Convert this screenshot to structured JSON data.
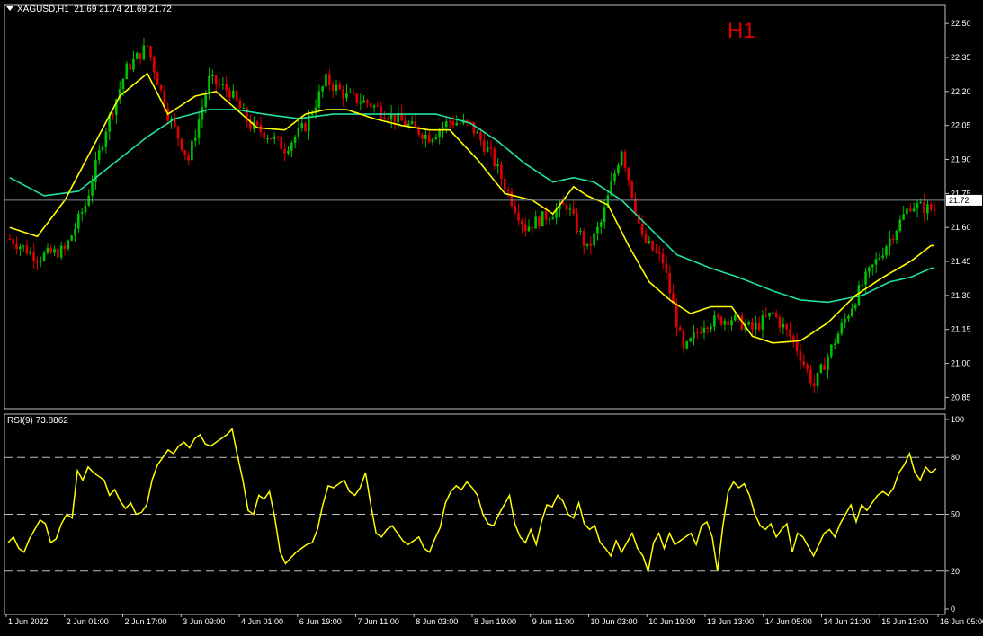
{
  "header": {
    "symbol_label": "XAGUSD,H1",
    "ohlc": "21.69 21.74 21.69 21.72"
  },
  "timeframe_label": "H1",
  "colors": {
    "background": "#000000",
    "axis": "#c0c0c0",
    "bull": "#00c000",
    "bear": "#e00000",
    "ma_fast": "#ffff00",
    "ma_slow": "#20e0a0",
    "rsi": "#ffff00",
    "level_line": "#c0c0c0",
    "current_price_line": "#8090a0"
  },
  "chart_data": [
    {
      "type": "candlestick",
      "title": "XAGUSD,H1",
      "ylim": [
        20.8,
        22.58
      ],
      "price_ticks": [
        "22.50",
        "22.35",
        "22.20",
        "22.05",
        "21.90",
        "21.75",
        "21.60",
        "21.45",
        "21.30",
        "21.15",
        "21.00",
        "20.85"
      ],
      "current_price": "21.72",
      "x_labels": [
        "1 Jun 2022",
        "2 Jun 01:00",
        "2 Jun 17:00",
        "3 Jun 09:00",
        "4 Jun 01:00",
        "6 Jun 19:00",
        "7 Jun 11:00",
        "8 Jun 03:00",
        "8 Jun 19:00",
        "9 Jun 11:00",
        "10 Jun 03:00",
        "10 Jun 19:00",
        "13 Jun 13:00",
        "14 Jun 05:00",
        "14 Jun 21:00",
        "15 Jun 13:00",
        "16 Jun 05:00"
      ],
      "close_path": [
        [
          0,
          21.55
        ],
        [
          8,
          21.47
        ],
        [
          16,
          21.5
        ],
        [
          22,
          21.7
        ],
        [
          28,
          22.04
        ],
        [
          34,
          22.3
        ],
        [
          40,
          22.4
        ],
        [
          46,
          22.1
        ],
        [
          52,
          21.9
        ],
        [
          58,
          22.25
        ],
        [
          64,
          22.2
        ],
        [
          70,
          22.05
        ],
        [
          76,
          22.0
        ],
        [
          80,
          21.95
        ],
        [
          86,
          22.05
        ],
        [
          92,
          22.25
        ],
        [
          98,
          22.18
        ],
        [
          104,
          22.15
        ],
        [
          110,
          22.1
        ],
        [
          116,
          22.05
        ],
        [
          122,
          22.0
        ],
        [
          128,
          22.07
        ],
        [
          134,
          22.05
        ],
        [
          140,
          21.92
        ],
        [
          146,
          21.72
        ],
        [
          150,
          21.6
        ],
        [
          156,
          21.65
        ],
        [
          162,
          21.7
        ],
        [
          168,
          21.5
        ],
        [
          172,
          21.62
        ],
        [
          178,
          21.95
        ],
        [
          184,
          21.55
        ],
        [
          190,
          21.45
        ],
        [
          196,
          21.05
        ],
        [
          202,
          21.18
        ],
        [
          210,
          21.2
        ],
        [
          216,
          21.15
        ],
        [
          222,
          21.22
        ],
        [
          228,
          21.1
        ],
        [
          234,
          20.9
        ],
        [
          240,
          21.1
        ],
        [
          248,
          21.35
        ],
        [
          254,
          21.5
        ],
        [
          262,
          21.7
        ],
        [
          268,
          21.68
        ]
      ],
      "ma_fast_path": [
        [
          0,
          21.6
        ],
        [
          8,
          21.56
        ],
        [
          16,
          21.72
        ],
        [
          24,
          21.95
        ],
        [
          32,
          22.18
        ],
        [
          40,
          22.28
        ],
        [
          46,
          22.1
        ],
        [
          54,
          22.18
        ],
        [
          60,
          22.2
        ],
        [
          66,
          22.12
        ],
        [
          72,
          22.04
        ],
        [
          80,
          22.03
        ],
        [
          86,
          22.1
        ],
        [
          92,
          22.12
        ],
        [
          98,
          22.12
        ],
        [
          106,
          22.08
        ],
        [
          114,
          22.05
        ],
        [
          122,
          22.03
        ],
        [
          128,
          22.03
        ],
        [
          136,
          21.9
        ],
        [
          144,
          21.75
        ],
        [
          152,
          21.72
        ],
        [
          158,
          21.66
        ],
        [
          164,
          21.78
        ],
        [
          168,
          21.74
        ],
        [
          174,
          21.7
        ],
        [
          180,
          21.52
        ],
        [
          186,
          21.36
        ],
        [
          192,
          21.28
        ],
        [
          198,
          21.22
        ],
        [
          204,
          21.25
        ],
        [
          210,
          21.25
        ],
        [
          216,
          21.12
        ],
        [
          222,
          21.09
        ],
        [
          230,
          21.1
        ],
        [
          238,
          21.18
        ],
        [
          246,
          21.3
        ],
        [
          254,
          21.38
        ],
        [
          262,
          21.45
        ],
        [
          268,
          21.52
        ]
      ],
      "ma_slow_path": [
        [
          0,
          21.82
        ],
        [
          10,
          21.74
        ],
        [
          20,
          21.76
        ],
        [
          30,
          21.88
        ],
        [
          40,
          22.0
        ],
        [
          48,
          22.08
        ],
        [
          58,
          22.12
        ],
        [
          66,
          22.12
        ],
        [
          74,
          22.1
        ],
        [
          84,
          22.08
        ],
        [
          94,
          22.1
        ],
        [
          104,
          22.1
        ],
        [
          114,
          22.1
        ],
        [
          124,
          22.1
        ],
        [
          134,
          22.06
        ],
        [
          142,
          21.98
        ],
        [
          150,
          21.88
        ],
        [
          158,
          21.8
        ],
        [
          164,
          21.82
        ],
        [
          170,
          21.8
        ],
        [
          178,
          21.72
        ],
        [
          186,
          21.6
        ],
        [
          194,
          21.48
        ],
        [
          204,
          21.42
        ],
        [
          212,
          21.38
        ],
        [
          222,
          21.32
        ],
        [
          230,
          21.28
        ],
        [
          238,
          21.27
        ],
        [
          248,
          21.3
        ],
        [
          256,
          21.36
        ],
        [
          262,
          21.38
        ],
        [
          268,
          21.42
        ]
      ]
    },
    {
      "type": "line",
      "title": "RSI(9) 73.8862",
      "ylim": [
        0,
        100
      ],
      "y_ticks": [
        "100",
        "80",
        "50",
        "20",
        "0"
      ],
      "levels": [
        80,
        50,
        20
      ],
      "series": [
        {
          "name": "RSI(9)",
          "values": [
            35,
            38,
            32,
            30,
            37,
            42,
            47,
            45,
            35,
            37,
            45,
            50,
            48,
            73,
            68,
            75,
            72,
            70,
            68,
            60,
            63,
            57,
            53,
            56,
            50,
            51,
            55,
            68,
            76,
            80,
            84,
            82,
            86,
            88,
            85,
            90,
            92,
            87,
            86,
            88,
            90,
            92,
            95,
            81,
            68,
            52,
            50,
            60,
            58,
            62,
            48,
            30,
            24,
            27,
            30,
            32,
            34,
            35,
            42,
            55,
            65,
            64,
            66,
            68,
            62,
            60,
            64,
            72,
            55,
            40,
            38,
            42,
            44,
            40,
            36,
            34,
            36,
            38,
            32,
            30,
            37,
            43,
            56,
            62,
            65,
            63,
            67,
            64,
            60,
            50,
            45,
            44,
            50,
            55,
            60,
            45,
            38,
            35,
            42,
            34,
            46,
            55,
            54,
            60,
            57,
            50,
            48,
            56,
            45,
            42,
            44,
            35,
            32,
            28,
            36,
            30,
            35,
            40,
            32,
            28,
            20,
            35,
            40,
            32,
            40,
            34,
            36,
            38,
            40,
            34,
            44,
            46,
            38,
            20,
            44,
            62,
            67,
            64,
            66,
            60,
            50,
            44,
            42,
            45,
            38,
            42,
            45,
            30,
            40,
            38,
            33,
            28,
            34,
            40,
            42,
            38,
            45,
            50,
            55,
            46,
            55,
            52,
            56,
            60,
            62,
            60,
            64,
            72,
            76,
            82,
            72,
            68,
            75,
            72,
            74
          ]
        }
      ]
    }
  ]
}
